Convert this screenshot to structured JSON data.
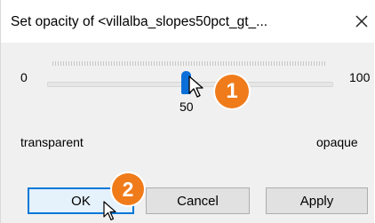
{
  "dialog": {
    "title": "Set opacity of <villalba_slopes50pct_gt_...",
    "close_icon": "close-icon"
  },
  "slider": {
    "min_label": "0",
    "max_label": "100",
    "value": "50",
    "level_percent": 50,
    "thumb_color": "#0a6fd8"
  },
  "labels": {
    "left": "transparent",
    "right": "opaque"
  },
  "callouts": {
    "first": "1",
    "second": "2",
    "color": "#f07b1a"
  },
  "buttons": {
    "ok": "OK",
    "cancel": "Cancel",
    "apply": "Apply"
  }
}
